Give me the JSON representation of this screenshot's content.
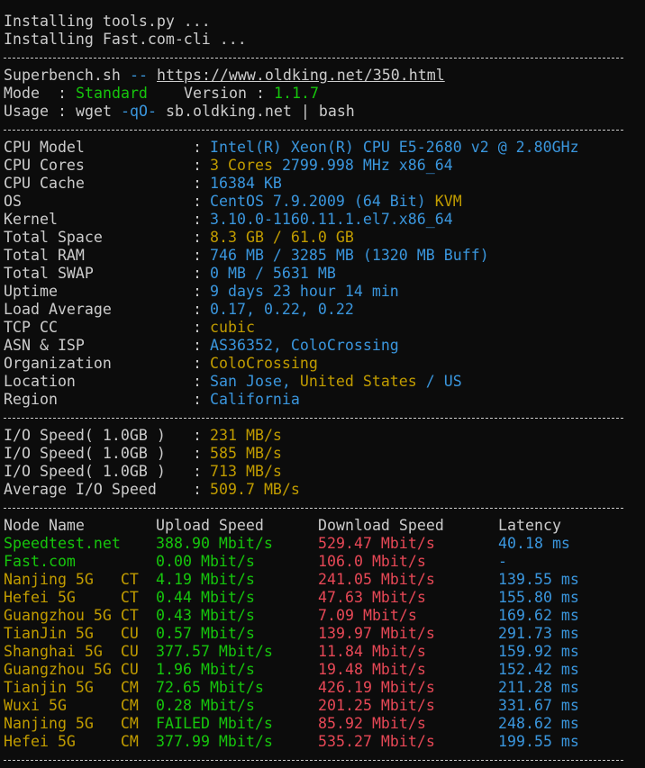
{
  "install": [
    "Installing tools.py ...",
    "Installing Fast.com-cli ..."
  ],
  "header": {
    "name": "Superbench.sh",
    "dashes": "--",
    "url": "https://www.oldking.net/350.html",
    "mode_label": "Mode",
    "mode_sep": ":",
    "mode_value": "Standard",
    "version_label": "Version",
    "version_sep": ":",
    "version_value": "1.1.7",
    "usage_label": "Usage",
    "usage_sep": ":",
    "usage_cmd": "wget",
    "usage_flag": "-qO-",
    "usage_rest": "sb.oldking.net | bash"
  },
  "system": [
    {
      "label": "CPU Model",
      "parts": [
        {
          "text": "Intel(R) Xeon(R) CPU E5-2680 v2 @ 2.80GHz",
          "color": "cyan"
        }
      ]
    },
    {
      "label": "CPU Cores",
      "parts": [
        {
          "text": "3 Cores ",
          "color": "yellow"
        },
        {
          "text": "2799.998 MHz x86_64",
          "color": "cyan"
        }
      ]
    },
    {
      "label": "CPU Cache",
      "parts": [
        {
          "text": "16384 KB",
          "color": "cyan"
        }
      ]
    },
    {
      "label": "OS",
      "parts": [
        {
          "text": "CentOS 7.9.2009 (64 Bit) ",
          "color": "cyan"
        },
        {
          "text": "KVM",
          "color": "yellow"
        }
      ]
    },
    {
      "label": "Kernel",
      "parts": [
        {
          "text": "3.10.0-1160.11.1.el7.x86_64",
          "color": "cyan"
        }
      ]
    },
    {
      "label": "Total Space",
      "parts": [
        {
          "text": "8.3 GB / 61.0 GB",
          "color": "yellow"
        }
      ]
    },
    {
      "label": "Total RAM",
      "parts": [
        {
          "text": "746 MB / 3285 MB (1320 MB Buff)",
          "color": "cyan"
        }
      ]
    },
    {
      "label": "Total SWAP",
      "parts": [
        {
          "text": "0 MB / 5631 MB",
          "color": "cyan"
        }
      ]
    },
    {
      "label": "Uptime",
      "parts": [
        {
          "text": "9 days 23 hour 14 min",
          "color": "cyan"
        }
      ]
    },
    {
      "label": "Load Average",
      "parts": [
        {
          "text": "0.17, 0.22, 0.22",
          "color": "cyan"
        }
      ]
    },
    {
      "label": "TCP CC",
      "parts": [
        {
          "text": "cubic",
          "color": "yellow"
        }
      ]
    },
    {
      "label": "ASN & ISP",
      "parts": [
        {
          "text": "AS36352, ColoCrossing",
          "color": "cyan"
        }
      ]
    },
    {
      "label": "Organization",
      "parts": [
        {
          "text": "ColoCrossing",
          "color": "yellow"
        }
      ]
    },
    {
      "label": "Location",
      "parts": [
        {
          "text": "San Jose, ",
          "color": "cyan"
        },
        {
          "text": "United States",
          "color": "yellow"
        },
        {
          "text": " / US",
          "color": "cyan"
        }
      ]
    },
    {
      "label": "Region",
      "parts": [
        {
          "text": "California",
          "color": "cyan"
        }
      ]
    }
  ],
  "io": [
    {
      "label": "I/O Speed( 1.0GB )",
      "value": "231 MB/s"
    },
    {
      "label": "I/O Speed( 1.0GB )",
      "value": "585 MB/s"
    },
    {
      "label": "I/O Speed( 1.0GB )",
      "value": "713 MB/s"
    },
    {
      "label": "Average I/O Speed",
      "value": "509.7 MB/s"
    }
  ],
  "speed": {
    "headers": [
      "Node Name",
      "Upload Speed",
      "Download Speed",
      "Latency"
    ],
    "rows": [
      {
        "node": "Speedtest.net",
        "up": "388.90 Mbit/s",
        "down": "529.47 Mbit/s",
        "lat": "40.18 ms"
      },
      {
        "node": "Fast.com",
        "up": "0.00 Mbit/s",
        "down": "106.0 Mbit/s",
        "lat": "-"
      },
      {
        "node": "Nanjing 5G   CT",
        "up": "4.19 Mbit/s",
        "down": "241.05 Mbit/s",
        "lat": "139.55 ms"
      },
      {
        "node": "Hefei 5G     CT",
        "up": "0.44 Mbit/s",
        "down": "47.63 Mbit/s",
        "lat": "155.80 ms"
      },
      {
        "node": "Guangzhou 5G CT",
        "up": "0.43 Mbit/s",
        "down": "7.09 Mbit/s",
        "lat": "169.62 ms"
      },
      {
        "node": "TianJin 5G   CU",
        "up": "0.57 Mbit/s",
        "down": "139.97 Mbit/s",
        "lat": "291.73 ms"
      },
      {
        "node": "Shanghai 5G  CU",
        "up": "377.57 Mbit/s",
        "down": "11.84 Mbit/s",
        "lat": "159.92 ms"
      },
      {
        "node": "Guangzhou 5G CU",
        "up": "1.96 Mbit/s",
        "down": "19.48 Mbit/s",
        "lat": "152.42 ms"
      },
      {
        "node": "Tianjin 5G   CM",
        "up": "72.65 Mbit/s",
        "down": "426.19 Mbit/s",
        "lat": "211.28 ms"
      },
      {
        "node": "Wuxi 5G      CM",
        "up": "0.28 Mbit/s",
        "down": "201.25 Mbit/s",
        "lat": "331.67 ms"
      },
      {
        "node": "Nanjing 5G   CM",
        "up": "FAILED Mbit/s",
        "down": "85.92 Mbit/s",
        "lat": "248.62 ms"
      },
      {
        "node": "Hefei 5G     CM",
        "up": "377.99 Mbit/s",
        "down": "535.27 Mbit/s",
        "lat": "199.55 ms"
      }
    ]
  },
  "colors": {
    "background": "#0c0c0c",
    "text": "#cccccc",
    "green": "#16c60c",
    "yellow": "#c19c00",
    "cyan": "#3a96dd",
    "red": "#e74856"
  }
}
